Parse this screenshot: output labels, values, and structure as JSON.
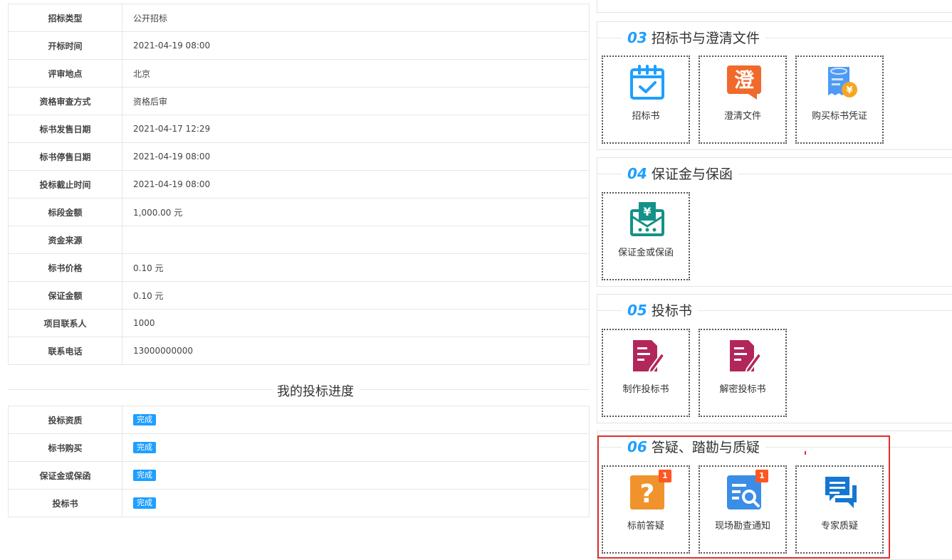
{
  "info_rows": [
    {
      "label": "招标类型",
      "value": "公开招标"
    },
    {
      "label": "开标时间",
      "value": "2021-04-19 08:00"
    },
    {
      "label": "评审地点",
      "value": "北京"
    },
    {
      "label": "资格审查方式",
      "value": "资格后审"
    },
    {
      "label": "标书发售日期",
      "value": "2021-04-17 12:29"
    },
    {
      "label": "标书停售日期",
      "value": "2021-04-19 08:00"
    },
    {
      "label": "投标截止时间",
      "value": "2021-04-19 08:00"
    },
    {
      "label": "标段金额",
      "value": "1,000.00 元"
    },
    {
      "label": "资金来源",
      "value": ""
    },
    {
      "label": "标书价格",
      "value": "0.10 元"
    },
    {
      "label": "保证金额",
      "value": "0.10 元"
    },
    {
      "label": "项目联系人",
      "value": "1000"
    },
    {
      "label": "联系电话",
      "value": "13000000000"
    }
  ],
  "progress": {
    "title": "我的投标进度",
    "rows": [
      {
        "label": "投标资质",
        "status": "完成"
      },
      {
        "label": "标书购买",
        "status": "完成"
      },
      {
        "label": "保证金或保函",
        "status": "完成"
      },
      {
        "label": "投标书",
        "status": "完成"
      }
    ]
  },
  "sections": {
    "s03": {
      "num": "03",
      "title": "招标书与澄清文件",
      "tiles": [
        {
          "label": "招标书"
        },
        {
          "label": "澄清文件"
        },
        {
          "label": "购买标书凭证"
        }
      ]
    },
    "s04": {
      "num": "04",
      "title": "保证金与保函",
      "tiles": [
        {
          "label": "保证金或保函"
        }
      ]
    },
    "s05": {
      "num": "05",
      "title": "投标书",
      "tiles": [
        {
          "label": "制作投标书"
        },
        {
          "label": "解密投标书"
        }
      ]
    },
    "s06": {
      "num": "06",
      "title": "答疑、踏勘与质疑",
      "tiles": [
        {
          "label": "标前答疑",
          "count": "1"
        },
        {
          "label": "现场勘查通知",
          "count": "1"
        },
        {
          "label": "专家质疑"
        }
      ]
    }
  },
  "icons": {
    "clarify_glyph": "澄",
    "yen_glyph": "¥",
    "question_glyph": "?"
  },
  "colors": {
    "accent_blue": "#1e9fff",
    "orange": "#f06a2c",
    "teal": "#149287",
    "maroon": "#b3265a",
    "badge_red": "#ff5722",
    "highlight_red": "#e32d2d"
  }
}
